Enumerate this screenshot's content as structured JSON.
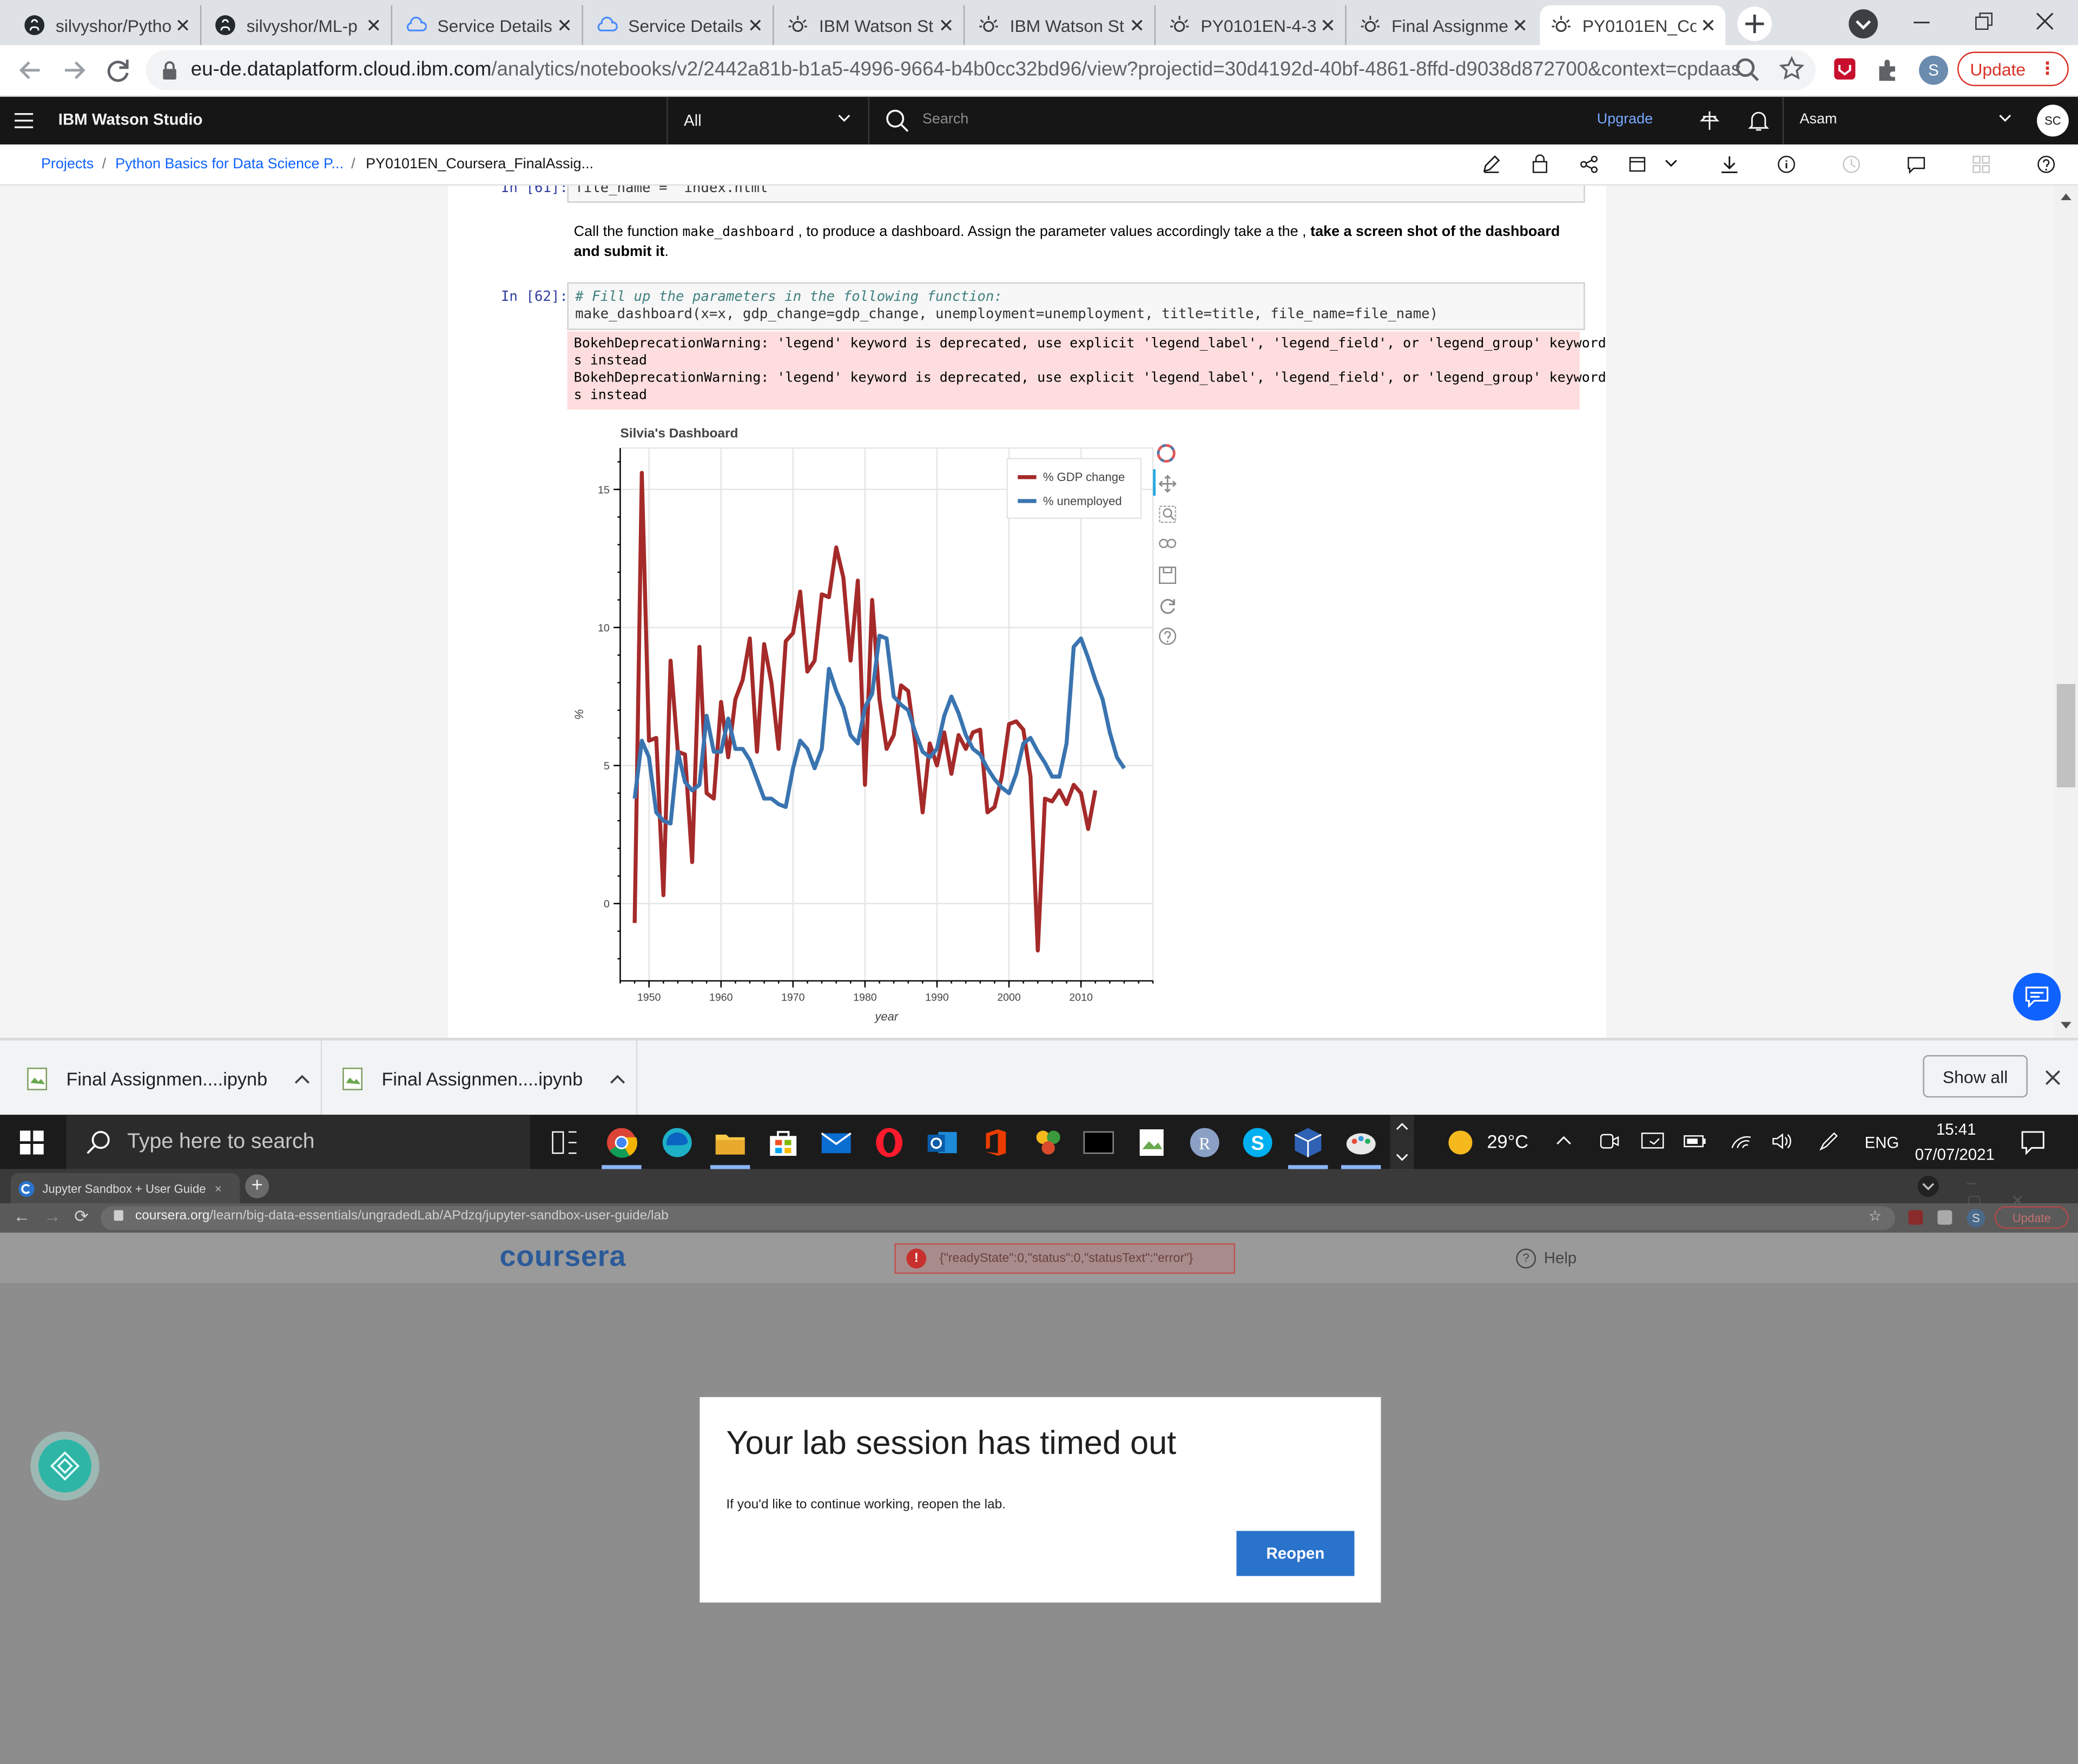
{
  "browser_top": {
    "tabs": [
      {
        "title": "silvyshor/Pytho",
        "icon": "github-icon"
      },
      {
        "title": "silvyshor/ML-p",
        "icon": "github-icon"
      },
      {
        "title": "Service Details",
        "icon": "ibm-cloud-icon"
      },
      {
        "title": "Service Details",
        "icon": "ibm-cloud-icon"
      },
      {
        "title": "IBM Watson St",
        "icon": "watson-icon"
      },
      {
        "title": "IBM Watson St",
        "icon": "watson-icon"
      },
      {
        "title": "PY0101EN-4-3",
        "icon": "watson-icon"
      },
      {
        "title": "Final Assignme",
        "icon": "watson-icon"
      },
      {
        "title": "PY0101EN_Co",
        "icon": "watson-icon",
        "active": true
      }
    ],
    "url_host": "eu-de.dataplatform.cloud.ibm.com",
    "url_path": "/analytics/notebooks/v2/2442a81b-b1a5-4996-9664-b4b0cc32bd96/view?projectid=30d4192d-40bf-4861-8ffd-d9038d872700&context=cpdaas",
    "update_label": "Update",
    "profile_initial": "S"
  },
  "watson": {
    "app_name": "IBM Watson Studio",
    "scope": "All",
    "search_placeholder": "Search",
    "upgrade_label": "Upgrade",
    "account": "Asam",
    "avatar": "SC",
    "breadcrumb": [
      "Projects",
      "Python Basics for Data Science P...",
      "PY0101EN_Coursera_FinalAssig..."
    ]
  },
  "notebook": {
    "cell61_prompt": "In [61]:",
    "cell61_code": "file_name = \"index.html\"",
    "markdown_text": "Call the function",
    "markdown_code": "make_dashboard",
    "markdown_text2": ", to produce a dashboard. Assign the parameter values accordingly take a the ,",
    "markdown_bold": "take a screen shot of the dashboard and submit it",
    "markdown_end": ".",
    "cell62_prompt": "In [62]:",
    "cell62_comment": "# Fill up the parameters in the following function:",
    "cell62_code": "make_dashboard(x=x, gdp_change=gdp_change, unemployment=unemployment, title=title, file_name=file_name)",
    "warning_lines": [
      "BokehDeprecationWarning: 'legend' keyword is deprecated, use explicit 'legend_label', 'legend_field', or 'legend_group' keyword",
      "s instead",
      "BokehDeprecationWarning: 'legend' keyword is deprecated, use explicit 'legend_label', 'legend_field', or 'legend_group' keyword",
      "s instead"
    ]
  },
  "chart_data": {
    "type": "line",
    "title": "Silvia's Dashboard",
    "xlabel": "year",
    "ylabel": "%",
    "xlim": [
      1946,
      2020
    ],
    "ylim": [
      -2.8,
      16.5
    ],
    "x_ticks": [
      1950,
      1960,
      1970,
      1980,
      1990,
      2000,
      2010
    ],
    "y_ticks": [
      0,
      5,
      10,
      15
    ],
    "grid": true,
    "legend_position": "top-right",
    "x": [
      1948,
      1949,
      1950,
      1951,
      1952,
      1953,
      1954,
      1955,
      1956,
      1957,
      1958,
      1959,
      1960,
      1961,
      1962,
      1963,
      1964,
      1965,
      1966,
      1967,
      1968,
      1969,
      1970,
      1971,
      1972,
      1973,
      1974,
      1975,
      1976,
      1977,
      1978,
      1979,
      1980,
      1981,
      1982,
      1983,
      1984,
      1985,
      1986,
      1987,
      1988,
      1989,
      1990,
      1991,
      1992,
      1993,
      1994,
      1995,
      1996,
      1997,
      1998,
      1999,
      2000,
      2001,
      2002,
      2003,
      2004,
      2005,
      2006,
      2007,
      2008,
      2009,
      2010,
      2011,
      2012,
      2013,
      2014,
      2015,
      2016
    ],
    "series": [
      {
        "name": "% GDP change",
        "color": "#a52a2a",
        "values": [
          -0.7,
          15.6,
          5.9,
          6.0,
          0.3,
          8.8,
          5.5,
          5.4,
          1.5,
          9.3,
          4.0,
          3.8,
          7.3,
          5.3,
          7.4,
          8.1,
          9.6,
          5.5,
          9.4,
          8.0,
          5.6,
          9.5,
          9.8,
          11.3,
          8.4,
          8.8,
          11.2,
          11.1,
          12.9,
          11.8,
          8.8,
          11.7,
          4.3,
          11.0,
          7.4,
          5.6,
          6.1,
          7.9,
          7.7,
          5.8,
          3.3,
          5.8,
          5.0,
          6.2,
          4.7,
          6.1,
          5.6,
          6.2,
          6.3,
          3.3,
          3.5,
          4.6,
          6.5,
          6.6,
          6.3,
          4.6,
          -1.7,
          3.8,
          3.7,
          4.1,
          3.6,
          4.3,
          4.0,
          2.7,
          4.1
        ]
      },
      {
        "name": "% unemployed",
        "color": "#3a74b0",
        "values": [
          3.8,
          5.9,
          5.3,
          3.3,
          3.0,
          2.9,
          5.5,
          4.4,
          4.1,
          4.3,
          6.8,
          5.5,
          5.5,
          6.7,
          5.6,
          5.6,
          5.2,
          4.5,
          3.8,
          3.8,
          3.6,
          3.5,
          4.9,
          5.9,
          5.6,
          4.9,
          5.6,
          8.5,
          7.7,
          7.1,
          6.1,
          5.8,
          7.1,
          7.6,
          9.7,
          9.6,
          7.5,
          7.2,
          7.0,
          6.2,
          5.5,
          5.3,
          5.6,
          6.8,
          7.5,
          6.9,
          6.1,
          5.6,
          5.4,
          4.9,
          4.5,
          4.2,
          4.0,
          4.7,
          5.8,
          6.0,
          5.5,
          5.1,
          4.6,
          4.6,
          5.8,
          9.3,
          9.6,
          8.9,
          8.1,
          7.4,
          6.2,
          5.3,
          4.9
        ]
      }
    ]
  },
  "downloads": {
    "items": [
      "Final Assignmen....ipynb",
      "Final Assignmen....ipynb"
    ],
    "show_all": "Show all"
  },
  "taskbar": {
    "search_placeholder": "Type here to search",
    "temperature": "29°C",
    "language": "ENG",
    "time": "15:41",
    "date": "07/07/2021"
  },
  "browser_bottom": {
    "tab_title": "Jupyter Sandbox + User Guide | C",
    "url_host": "coursera.org",
    "url_path": "/learn/big-data-essentials/ungradedLab/APdzq/jupyter-sandbox-user-guide/lab",
    "update_label": "Update",
    "profile_initial": "S",
    "logo": "coursera",
    "error_text": "{\"readyState\":0,\"status\":0,\"statusText\":\"error\"}",
    "help_label": "Help",
    "modal_title": "Your lab session has timed out",
    "modal_body": "If you'd like to continue working, reopen the lab.",
    "reopen_label": "Reopen"
  }
}
